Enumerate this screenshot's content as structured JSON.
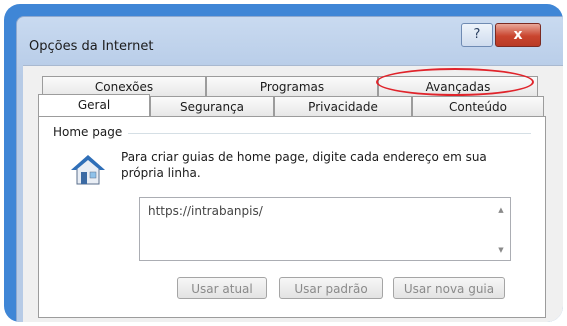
{
  "window": {
    "title": "Opções da Internet",
    "help_label": "?",
    "close_label": "x"
  },
  "tabs": {
    "row1": [
      "Conexões",
      "Programas",
      "Avançadas"
    ],
    "row2": [
      "Geral",
      "Segurança",
      "Privacidade",
      "Conteúdo"
    ],
    "active": "Geral",
    "highlighted": "Avançadas"
  },
  "home_page": {
    "section_label": "Home page",
    "description": "Para criar guias de home page, digite cada endereço em sua própria linha.",
    "url": "https://intrabanpis/",
    "buttons": {
      "use_current": "Usar atual",
      "use_default": "Usar padrão",
      "use_new_tab": "Usar nova guia"
    }
  },
  "colors": {
    "frame_border": "#3f86d6",
    "highlight_ellipse": "#e0242b",
    "close_button": "#c9452f"
  },
  "icons": [
    "house-icon",
    "help-icon",
    "close-icon",
    "scroll-up-icon",
    "scroll-down-icon"
  ]
}
